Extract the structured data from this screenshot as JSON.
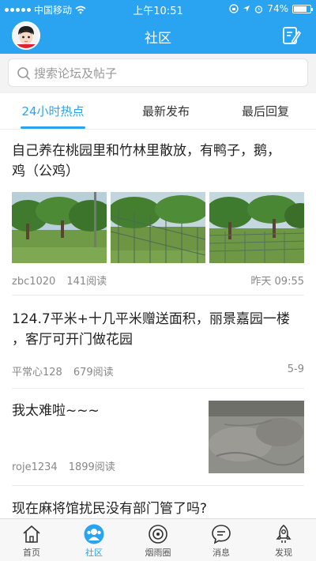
{
  "status_bar": {
    "carrier": "中国移动",
    "time": "上午10:51",
    "battery": "74%",
    "battery_level": 0.74
  },
  "header": {
    "title": "社区"
  },
  "search": {
    "placeholder": "搜索论坛及帖子"
  },
  "tabs": [
    {
      "label": "24小时热点",
      "active": true
    },
    {
      "label": "最新发布",
      "active": false
    },
    {
      "label": "最后回复",
      "active": false
    }
  ],
  "posts": [
    {
      "title_line1": "自己养在桃园里和竹林里散放，有鸭子，鹅，",
      "title_line2": "鸡（公鸡）",
      "author": "zbc1020",
      "reads": "141阅读",
      "time": "昨天 09:55"
    },
    {
      "title_line1": "124.7平米+十几平米赠送面积，丽景嘉园一楼",
      "title_line2": "，客厅可开门做花园",
      "author": "平常心128",
      "reads": "679阅读",
      "time": "5-9"
    },
    {
      "title_line1": "我太难啦~~~",
      "author": "roje1234",
      "reads": "1899阅读"
    },
    {
      "title_line1": "现在麻将馆扰民没有部门管了吗?"
    }
  ],
  "bottom_nav": [
    {
      "label": "首页",
      "icon": "home-icon",
      "active": false
    },
    {
      "label": "社区",
      "icon": "community-icon",
      "active": true
    },
    {
      "label": "烟雨圈",
      "icon": "circle-icon",
      "active": false
    },
    {
      "label": "消息",
      "icon": "message-icon",
      "active": false
    },
    {
      "label": "发现",
      "icon": "rocket-icon",
      "active": false
    }
  ],
  "colors": {
    "accent": "#2aa3f0"
  }
}
